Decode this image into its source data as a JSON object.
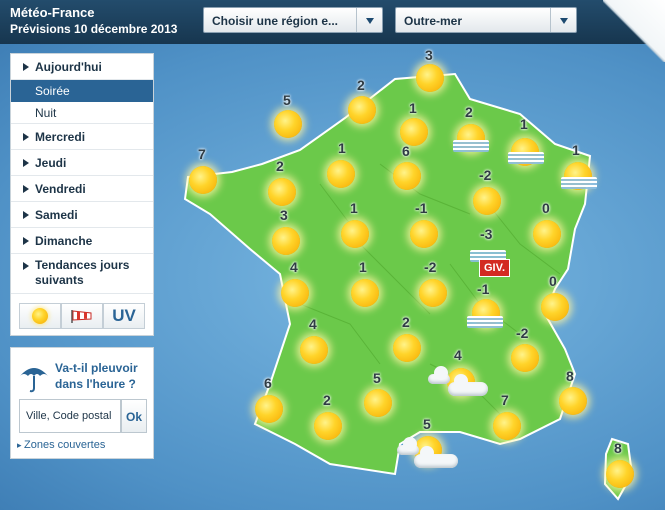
{
  "header": {
    "title": "Météo-France",
    "subtitle": "Prévisions 10 décembre 2013",
    "region_select": "Choisir une région e...",
    "overseas_select": "Outre-mer"
  },
  "nav": {
    "today": "Aujourd'hui",
    "evening": "Soirée",
    "night": "Nuit",
    "wednesday": "Mercredi",
    "thursday": "Jeudi",
    "friday": "Vendredi",
    "saturday": "Samedi",
    "sunday": "Dimanche",
    "trends_line1": "Tendances jours",
    "trends_line2": "suivants",
    "uv": "UV"
  },
  "rain": {
    "title_line1": "Va-t-il pleuvoir",
    "title_line2": "dans l'heure ?",
    "placeholder": "Ville, Code postal",
    "ok": "Ok",
    "link": "Zones couvertes"
  },
  "map": {
    "temps": {
      "t1": "3",
      "t2": "5",
      "t3": "2",
      "t4": "1",
      "t5": "2",
      "t6": "1",
      "t7": "1",
      "t8": "7",
      "t9": "2",
      "t10": "1",
      "t11": "6",
      "t12": "-2",
      "t13": "3",
      "t14": "1",
      "t15": "-1",
      "t16": "0",
      "t17": "-3",
      "t18": "4",
      "t19": "1",
      "t20": "-2",
      "t21": "-1",
      "t22": "0",
      "t23": "4",
      "t24": "2",
      "t25": "-2",
      "t26": "4",
      "t27": "6",
      "t28": "5",
      "t29": "8",
      "t30": "2",
      "t31": "7",
      "t32": "5",
      "t33": "8"
    },
    "alert": "GIV."
  }
}
